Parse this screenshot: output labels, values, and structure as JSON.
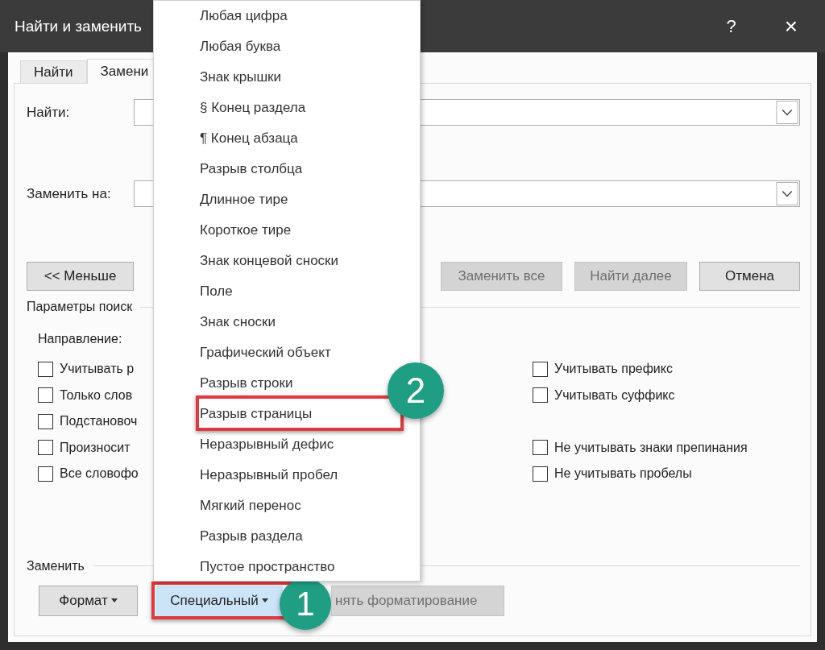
{
  "window": {
    "title": "Найти и заменить",
    "help_button": "?",
    "close_button": "×"
  },
  "tabs": [
    {
      "label": "Найти",
      "selected": false
    },
    {
      "label": "Замени",
      "selected": true
    }
  ],
  "find": {
    "label": "Найти:"
  },
  "replace": {
    "label": "Заменить на:"
  },
  "buttons": [
    {
      "label": "<< Меньше",
      "disabled": false
    },
    {
      "label": "Заменить все",
      "disabled": true
    },
    {
      "label": "Найти далее",
      "disabled": true
    },
    {
      "label": "Отмена",
      "disabled": false
    }
  ],
  "search_options": {
    "title": "Параметры поиск",
    "direction_label": "Направление:",
    "left": [
      {
        "label": "Учитывать р",
        "checked": false
      },
      {
        "label": "Только слов",
        "checked": false
      },
      {
        "label": "Подстановоч",
        "checked": false
      },
      {
        "label": "Произносит",
        "checked": false
      },
      {
        "label": "Все словофо",
        "checked": false
      }
    ],
    "affixes": [
      {
        "label": "Учитывать префикс",
        "checked": false
      },
      {
        "label": "Учитывать суффикс",
        "checked": false
      }
    ],
    "ignore": [
      {
        "label": "Не учитывать знаки препинания",
        "checked": false
      },
      {
        "label": "Не учитывать пробелы",
        "checked": false
      }
    ]
  },
  "replace_group": {
    "title": "Заменить",
    "buttons": [
      {
        "label": "Формат",
        "kind": "menu",
        "disabled": false,
        "pressed": false
      },
      {
        "label": "Специальный",
        "kind": "menu",
        "disabled": false,
        "pressed": true,
        "callout": "1"
      },
      {
        "label": "нять форматирование",
        "kind": "plain",
        "disabled": true,
        "pressed": false
      }
    ]
  },
  "special_menu": {
    "items": [
      {
        "label": "Любая цифра"
      },
      {
        "label": "Любая буква"
      },
      {
        "label": "Знак крышки"
      },
      {
        "label": "§ Конец раздела"
      },
      {
        "label": "¶ Конец абзаца"
      },
      {
        "label": "Разрыв столбца"
      },
      {
        "label": "Длинное тире"
      },
      {
        "label": "Короткое тире"
      },
      {
        "label": "Знак концевой сноски"
      },
      {
        "label": "Поле"
      },
      {
        "label": "Знак сноски"
      },
      {
        "label": "Графический объект"
      },
      {
        "label": "Разрыв строки"
      },
      {
        "label": "Разрыв страницы",
        "callout": "2"
      },
      {
        "label": "Неразрывный дефис"
      },
      {
        "label": "Неразрывный пробел"
      },
      {
        "label": "Мягкий перенос"
      },
      {
        "label": "Разрыв раздела"
      },
      {
        "label": "Пустое пространство"
      }
    ]
  }
}
